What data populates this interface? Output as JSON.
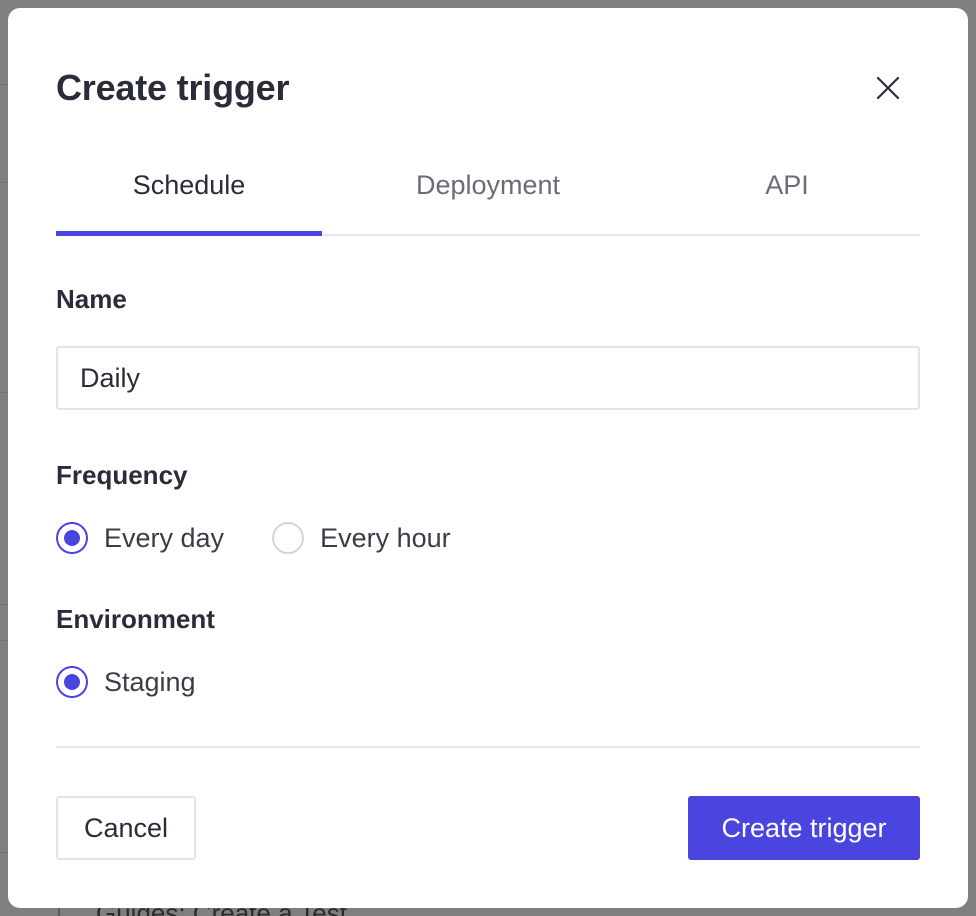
{
  "background": {
    "guide_text": "Guides: Create a Test"
  },
  "modal": {
    "title": "Create trigger",
    "close_icon": "close-icon",
    "tabs": [
      {
        "label": "Schedule",
        "active": true
      },
      {
        "label": "Deployment",
        "active": false
      },
      {
        "label": "API",
        "active": false
      }
    ],
    "name_field": {
      "label": "Name",
      "value": "Daily"
    },
    "frequency": {
      "label": "Frequency",
      "options": [
        {
          "label": "Every day",
          "checked": true
        },
        {
          "label": "Every hour",
          "checked": false
        }
      ]
    },
    "environment": {
      "label": "Environment",
      "options": [
        {
          "label": "Staging",
          "checked": true
        }
      ]
    },
    "footer": {
      "cancel_label": "Cancel",
      "create_label": "Create trigger"
    }
  },
  "colors": {
    "accent": "#4b45e0",
    "overlay": "#838385",
    "text_primary": "#2a2c3a",
    "text_muted": "#6a6c78",
    "border": "#e3e4e8"
  }
}
